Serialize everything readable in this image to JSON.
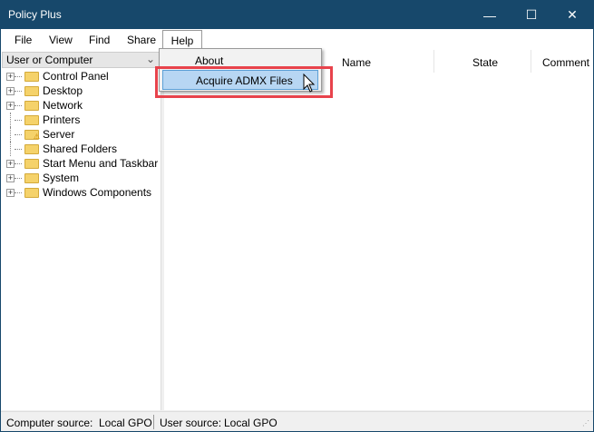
{
  "window": {
    "title": "Policy Plus",
    "minimize": "—",
    "maximize": "☐",
    "close": "✕"
  },
  "menubar": [
    "File",
    "View",
    "Find",
    "Share",
    "Help"
  ],
  "help_menu": {
    "items": [
      "About",
      "Acquire ADMX Files"
    ],
    "highlighted": "Acquire ADMX Files"
  },
  "left": {
    "scope_select": "User or Computer",
    "tree": [
      {
        "label": "Control Panel",
        "expandable": true
      },
      {
        "label": "Desktop",
        "expandable": true
      },
      {
        "label": "Network",
        "expandable": true
      },
      {
        "label": "Printers",
        "expandable": false
      },
      {
        "label": "Server",
        "expandable": false,
        "warning": true
      },
      {
        "label": "Shared Folders",
        "expandable": false
      },
      {
        "label": "Start Menu and Taskbar",
        "expandable": true
      },
      {
        "label": "System",
        "expandable": true
      },
      {
        "label": "Windows Components",
        "expandable": true
      }
    ]
  },
  "columns": [
    "Name",
    "State",
    "Comment"
  ],
  "status": {
    "computer_label": "Computer source:",
    "computer_value": "Local GPO",
    "user_label": "User source:",
    "user_value": "Local GPO"
  },
  "colors": {
    "titlebar": "#17486b",
    "highlight": "#b7d6f3",
    "annotation": "#e8434c"
  }
}
